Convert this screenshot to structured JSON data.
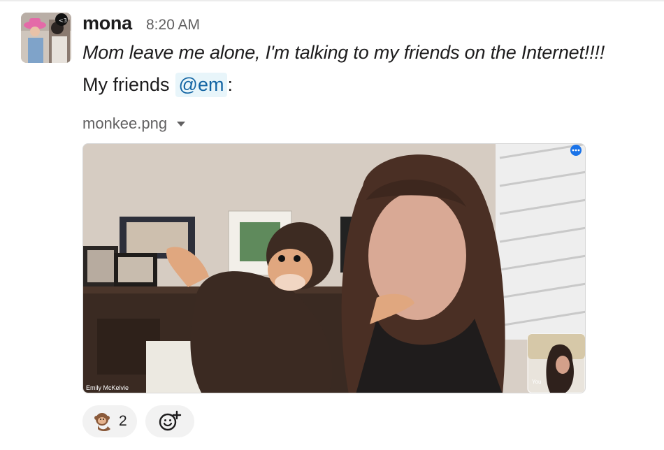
{
  "message": {
    "username": "mona",
    "timestamp": "8:20 AM",
    "line1": "Mom leave me alone, I'm talking to my friends on the Internet!!!!",
    "line2_prefix": "My friends",
    "mention": "@em",
    "line2_suffix": ":"
  },
  "attachment": {
    "filename": "monkee.png",
    "participant_name": "Emily McKelvie",
    "self_view_label": "You"
  },
  "reactions": [
    {
      "icon": "monkey-emoji-icon",
      "count": "2"
    }
  ],
  "colors": {
    "mention_bg": "#e8f5fa",
    "mention_text": "#1264a3",
    "reaction_bg": "#f2f2f2"
  }
}
